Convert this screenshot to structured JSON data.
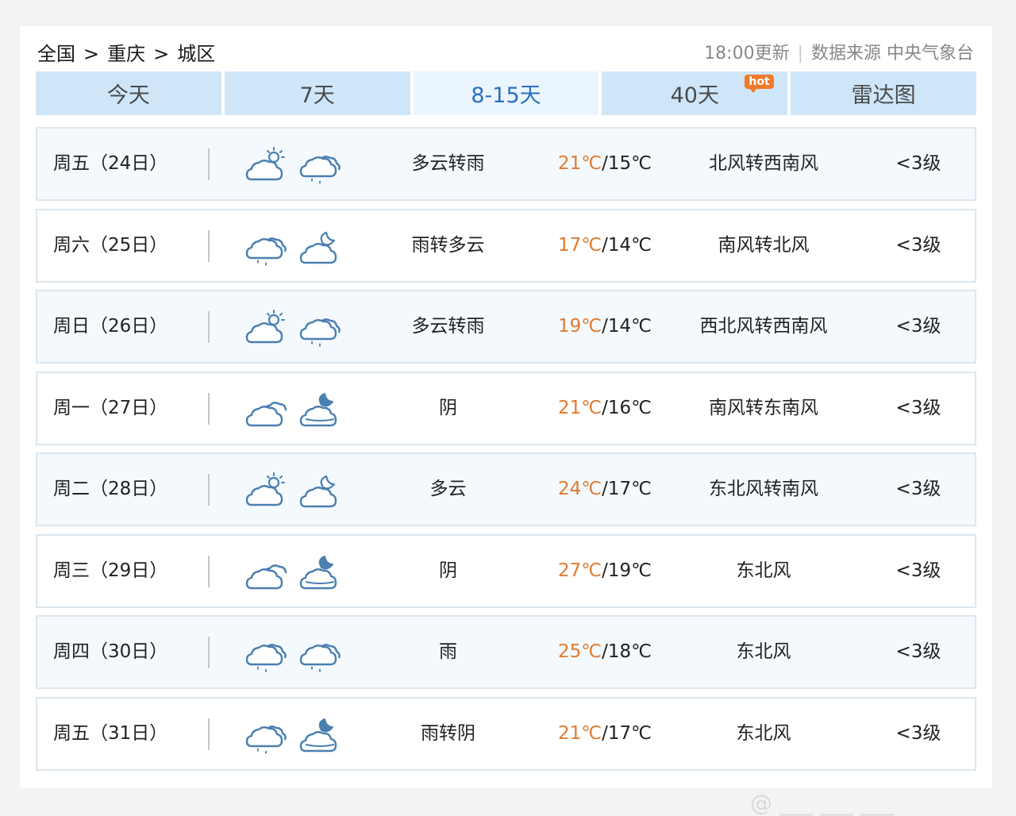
{
  "breadcrumb": {
    "country": "全国",
    "city": "重庆",
    "district": "城区",
    "separator": ">"
  },
  "meta": {
    "updated": "18:00更新",
    "source": "数据来源 中央气象台"
  },
  "tabs": [
    {
      "label": "今天"
    },
    {
      "label": "7天"
    },
    {
      "label": "8-15天"
    },
    {
      "label": "40天",
      "badge": "hot"
    },
    {
      "label": "雷达图"
    }
  ],
  "active_tab": "8-15天",
  "colors": {
    "accent": "#2c6fbf",
    "high_temp": "#e07a2e",
    "tab_bg": "#cfe6f9",
    "hot_badge": "#f07a2a"
  },
  "forecast": [
    {
      "day": "周五（24日）",
      "icons": [
        "partly-cloudy-sun-icon",
        "rain-cloud-icon"
      ],
      "desc": "多云转雨",
      "high": "21℃",
      "low": "/15℃",
      "wind": "北风转西南风",
      "level": "<3级"
    },
    {
      "day": "周六（25日）",
      "icons": [
        "rain-cloud-icon",
        "partly-cloudy-night-icon"
      ],
      "desc": "雨转多云",
      "high": "17℃",
      "low": "/14℃",
      "wind": "南风转北风",
      "level": "<3级"
    },
    {
      "day": "周日（26日）",
      "icons": [
        "partly-cloudy-sun-icon",
        "rain-cloud-icon"
      ],
      "desc": "多云转雨",
      "high": "19℃",
      "low": "/14℃",
      "wind": "西北风转西南风",
      "level": "<3级"
    },
    {
      "day": "周一（27日）",
      "icons": [
        "overcast-icon",
        "overcast-night-icon"
      ],
      "desc": "阴",
      "high": "21℃",
      "low": "/16℃",
      "wind": "南风转东南风",
      "level": "<3级"
    },
    {
      "day": "周二（28日）",
      "icons": [
        "partly-cloudy-sun-icon",
        "partly-cloudy-night-icon"
      ],
      "desc": "多云",
      "high": "24℃",
      "low": "/17℃",
      "wind": "东北风转南风",
      "level": "<3级"
    },
    {
      "day": "周三（29日）",
      "icons": [
        "overcast-icon",
        "overcast-night-icon"
      ],
      "desc": "阴",
      "high": "27℃",
      "low": "/19℃",
      "wind": "东北风",
      "level": "<3级"
    },
    {
      "day": "周四（30日）",
      "icons": [
        "rain-cloud-icon",
        "rain-cloud-icon"
      ],
      "desc": "雨",
      "high": "25℃",
      "low": "/18℃",
      "wind": "东北风",
      "level": "<3级"
    },
    {
      "day": "周五（31日）",
      "icons": [
        "rain-cloud-icon",
        "overcast-night-icon"
      ],
      "desc": "雨转阴",
      "high": "21℃",
      "low": "/17℃",
      "wind": "东北风",
      "level": "<3级"
    }
  ]
}
